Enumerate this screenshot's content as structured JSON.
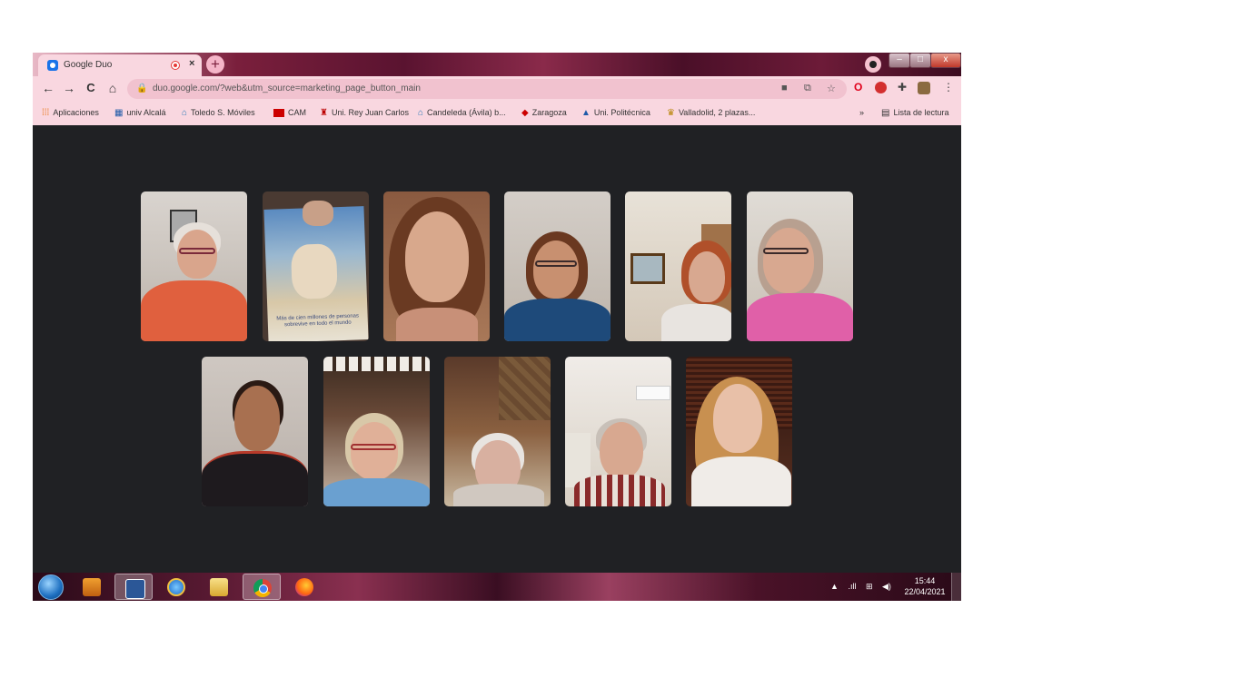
{
  "browser": {
    "tab_title": "Google Duo",
    "tab_close": "×",
    "new_tab": "+",
    "url": "duo.google.com/?web&utm_source=marketing_page_button_main",
    "window_controls": {
      "minimize": "–",
      "maximize": "□",
      "close": "x"
    }
  },
  "toolbar": {
    "back": "←",
    "forward": "→",
    "reload": "C",
    "home": "⌂",
    "star": "☆",
    "menu": "⋮"
  },
  "bookmarks": {
    "items": [
      {
        "label": "Aplicaciones",
        "icon": "apps-grid-icon"
      },
      {
        "label": "univ Alcalá",
        "icon": "building-icon"
      },
      {
        "label": "Toledo S. Móviles",
        "icon": "building-icon"
      },
      {
        "label": "CAM",
        "icon": "cam-flag-icon"
      },
      {
        "label": "Uni. Rey Juan Carlos",
        "icon": "tower-icon"
      },
      {
        "label": "Candeleda (Ávila) b...",
        "icon": "building-icon"
      },
      {
        "label": "Zaragoza",
        "icon": "shield-icon"
      },
      {
        "label": "Uni. Politécnica",
        "icon": "building-icon"
      },
      {
        "label": "Valladolid, 2 plazas...",
        "icon": "crest-icon"
      }
    ],
    "overflow": "»",
    "reading_list": "Lista de lectura"
  },
  "call": {
    "participants_count": 11,
    "book_caption": "Más de cien millones de personas sobrevive en todo el mundo"
  },
  "taskbar": {
    "apps": [
      "media-player",
      "word",
      "internet-explorer",
      "file-explorer",
      "chrome",
      "firefox"
    ],
    "tray_arrow": "▲",
    "time": "15:44",
    "date": "22/04/2021"
  },
  "colors": {
    "chrome_frame": "#f9d7e0",
    "omnibox": "#f1c2cf",
    "call_background": "#202124"
  }
}
